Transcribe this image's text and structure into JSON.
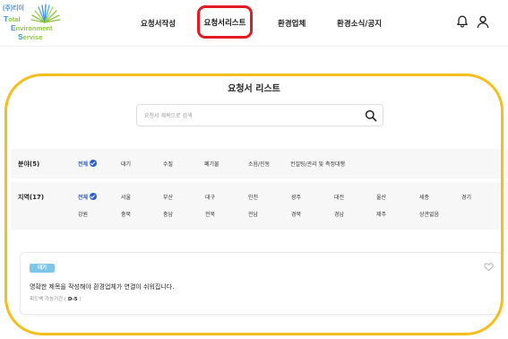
{
  "logo": {
    "prefix": "(주)티이",
    "line1_cap": "T",
    "line1_rest": "otal",
    "line2_cap": "E",
    "line2_rest": "nvironment",
    "line3_cap": "S",
    "line3_rest": "ervise"
  },
  "nav": {
    "items": [
      "요청서작성",
      "요청서리스트",
      "환경업체",
      "환경소식/공지"
    ],
    "active_index": 1
  },
  "header_icons": [
    "bell-icon",
    "user-icon"
  ],
  "page": {
    "title": "요청서 리스트",
    "search_placeholder": "요청서 제목으로 검색"
  },
  "filters": {
    "field": {
      "label": "분야(5)",
      "options": [
        "전체",
        "대기",
        "수질",
        "폐기물",
        "소음/진동",
        "컨설팅/관리 및 측정대행"
      ]
    },
    "region": {
      "label": "지역(17)",
      "options_row1": [
        "전체",
        "서울",
        "부산",
        "대구",
        "인천",
        "광주",
        "대전",
        "울산",
        "세종",
        "경기"
      ],
      "options_row2": [
        "강원",
        "충북",
        "충남",
        "전북",
        "전남",
        "경북",
        "경남",
        "제주",
        "상관없음"
      ]
    }
  },
  "card": {
    "badge": "대기",
    "title": "명확한 제목을 작성해야 환경업체가 연결이 쉬워집니다.",
    "meta_label": "피드백 가능기간 (",
    "meta_value": "D-5",
    "meta_end": ")"
  },
  "colors": {
    "accent": "#2b5fc9",
    "highlight_red": "#e31b23",
    "highlight_yellow": "#f6be1c",
    "badge": "#7ec6e8",
    "logo_blue": "#3f8fd4",
    "logo_green": "#8dc63f"
  }
}
